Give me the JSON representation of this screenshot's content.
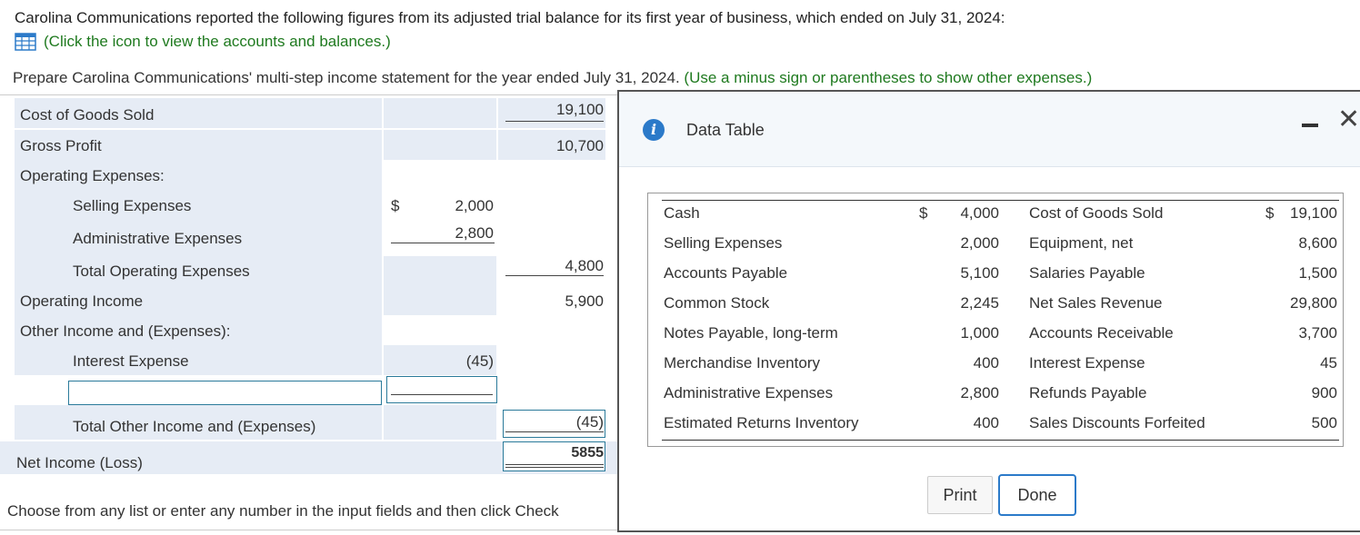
{
  "intro": {
    "text": "Carolina Communications reported the following figures from its adjusted trial balance for its first year of business, which ended on July 31, 2024:",
    "link_text": "(Click the icon to view the accounts and balances.)"
  },
  "prompt": {
    "text": "Prepare Carolina Communications' multi-step income statement for the year ended July 31, 2024.",
    "hint": "(Use a minus sign or parentheses to show other expenses.)"
  },
  "worksheet": {
    "cogs_label": "Cost of Goods Sold",
    "cogs_value": "19,100",
    "gross_label": "Gross Profit",
    "gross_value": "10,700",
    "opex_label": "Operating Expenses:",
    "selling_label": "Selling Expenses",
    "currency": "$",
    "selling_value": "2,000",
    "admin_label": "Administrative Expenses",
    "admin_value": "2,800",
    "total_opex_label": "Total Operating Expenses",
    "total_opex_value": "4,800",
    "opinc_label": "Operating Income",
    "opinc_value": "5,900",
    "other_label": "Other Income and (Expenses):",
    "interest_label": "Interest Expense",
    "interest_value": "(45)",
    "total_other_label": "Total Other Income and (Expenses)",
    "total_other_value": "(45)",
    "net_label": "Net Income (Loss)",
    "net_value": "5855"
  },
  "bottom_text": "Choose from any list or enter any number in the input fields and then click Check",
  "modal": {
    "title": "Data Table",
    "currency": "$",
    "left_accounts": [
      {
        "name": "Cash",
        "value": "4,000"
      },
      {
        "name": "Selling Expenses",
        "value": "2,000"
      },
      {
        "name": "Accounts Payable",
        "value": "5,100"
      },
      {
        "name": "Common Stock",
        "value": "2,245"
      },
      {
        "name": "Notes Payable, long-term",
        "value": "1,000"
      },
      {
        "name": "Merchandise Inventory",
        "value": "400"
      },
      {
        "name": "Administrative Expenses",
        "value": "2,800"
      },
      {
        "name": "Estimated Returns Inventory",
        "value": "400"
      }
    ],
    "right_accounts": [
      {
        "name": "Cost of Goods Sold",
        "value": "19,100"
      },
      {
        "name": "Equipment, net",
        "value": "8,600"
      },
      {
        "name": "Salaries Payable",
        "value": "1,500"
      },
      {
        "name": "Net Sales Revenue",
        "value": "29,800"
      },
      {
        "name": "Accounts Receivable",
        "value": "3,700"
      },
      {
        "name": "Interest Expense",
        "value": "45"
      },
      {
        "name": "Refunds Payable",
        "value": "900"
      },
      {
        "name": "Sales Discounts Forfeited",
        "value": "500"
      }
    ],
    "print_label": "Print",
    "done_label": "Done"
  }
}
